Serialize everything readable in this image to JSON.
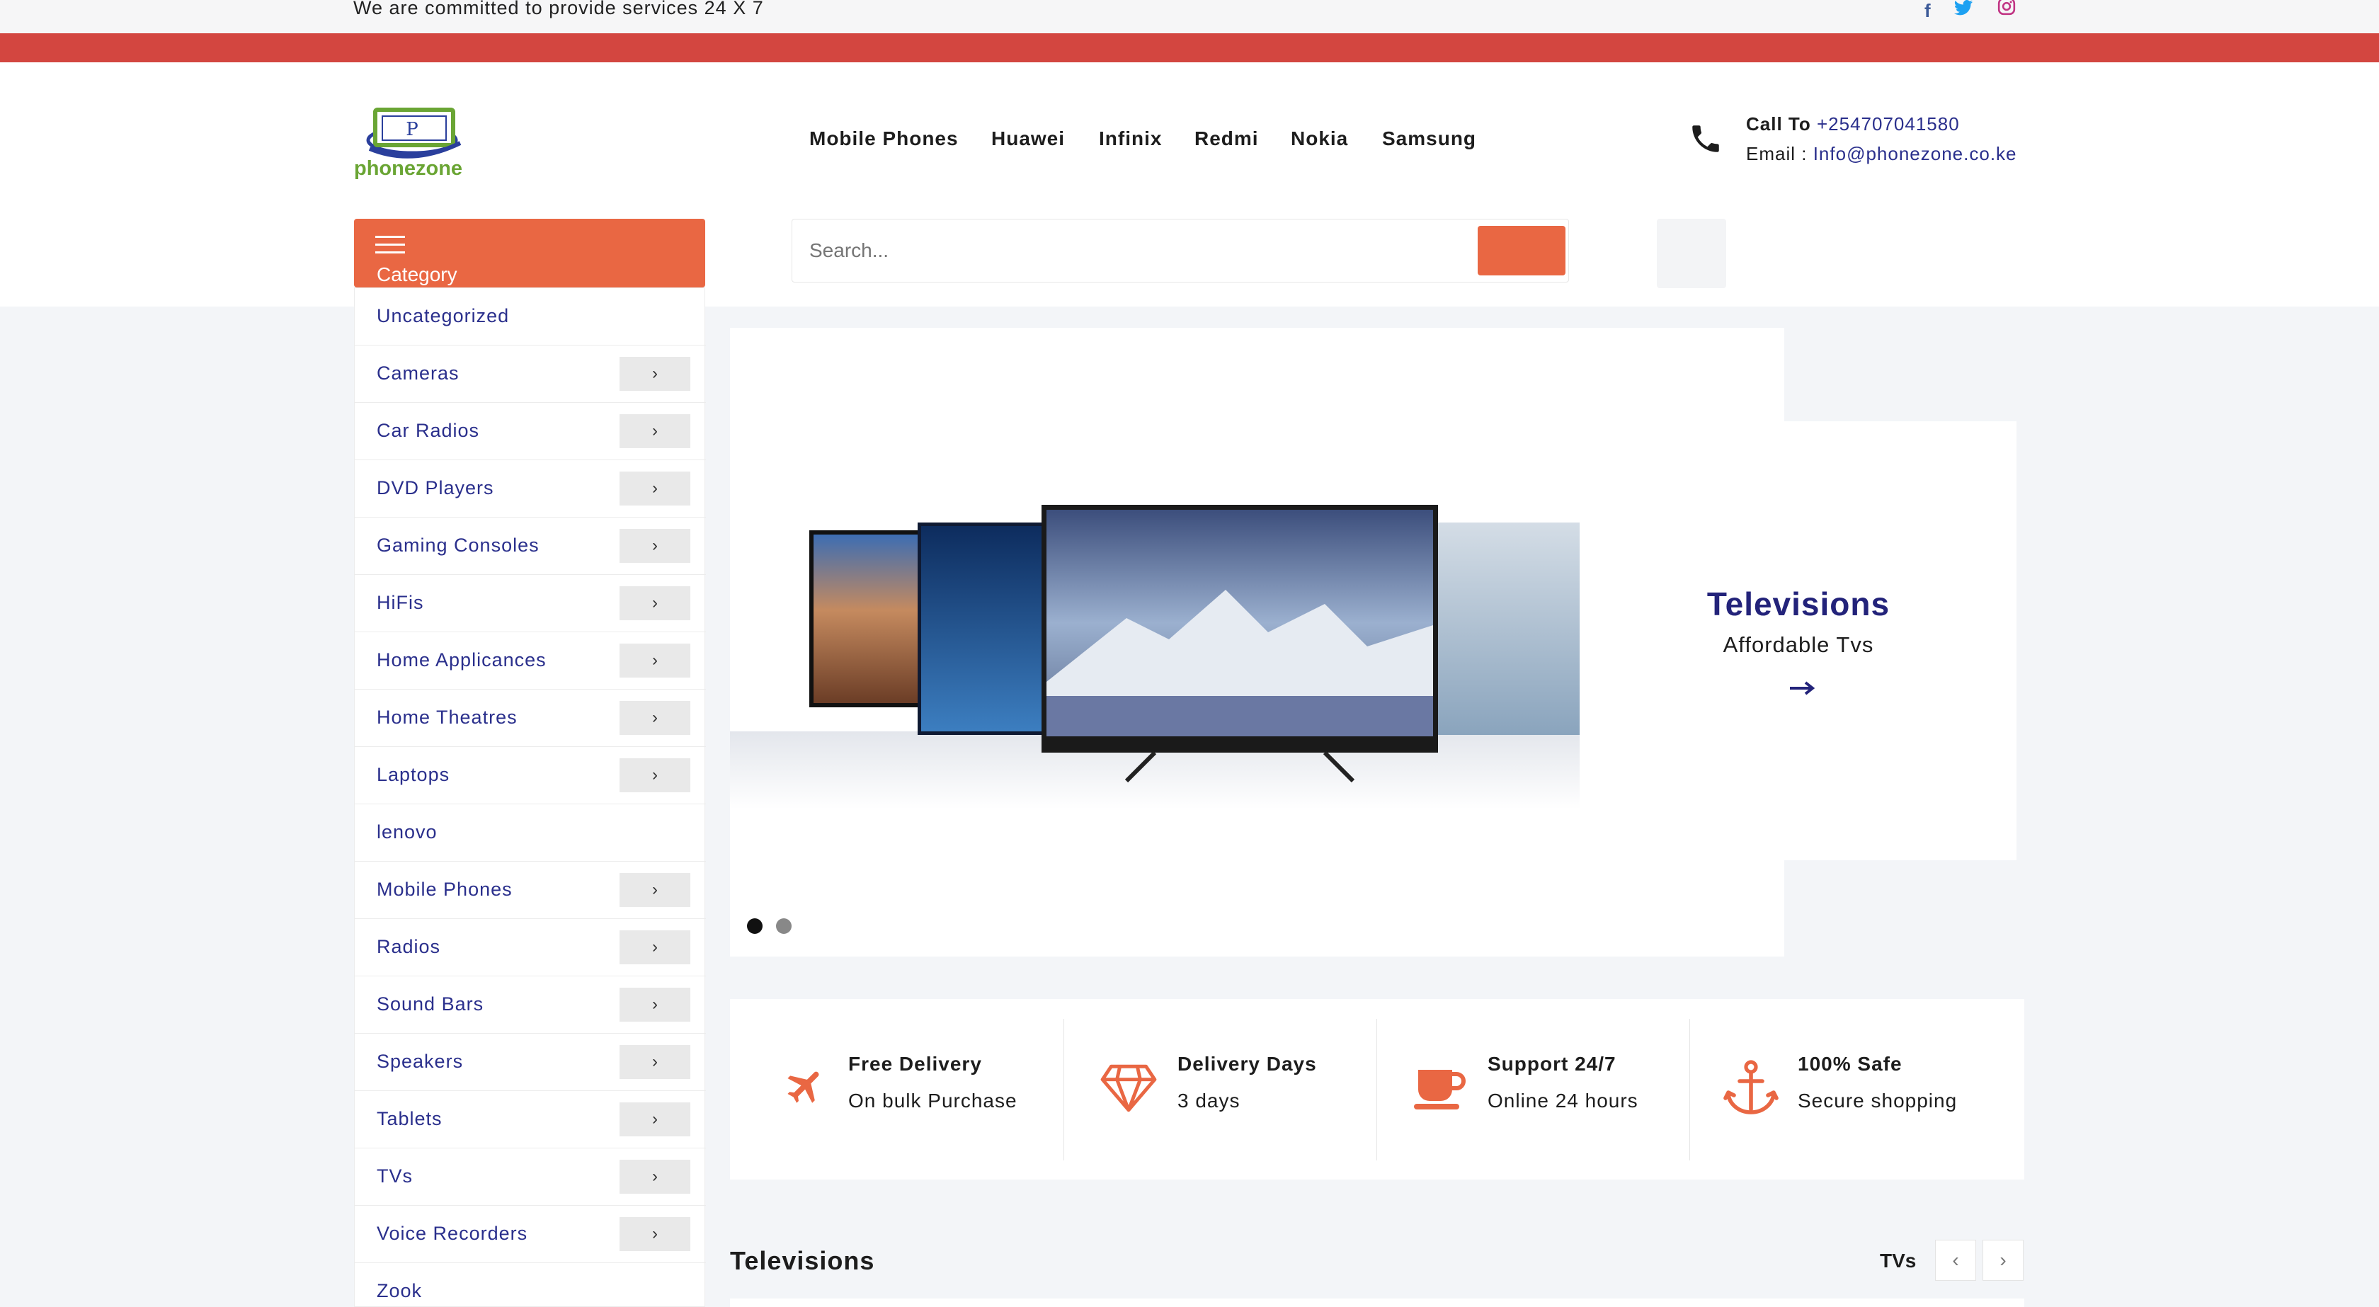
{
  "topbar": {
    "text": "We are committed to provide services 24 X 7",
    "social": [
      {
        "name": "facebook-icon",
        "glyph": "f",
        "color": "#3b5998"
      },
      {
        "name": "twitter-icon",
        "glyph": "🐦",
        "color": "#1da1f2"
      },
      {
        "name": "instagram-icon",
        "glyph": "◎",
        "color": "#c13584"
      }
    ]
  },
  "header": {
    "logo_text": "phonezone",
    "nav": [
      "Mobile Phones",
      "Huawei",
      "Infinix",
      "Redmi",
      "Nokia",
      "Samsung"
    ],
    "call_label": "Call To",
    "call_value": "+254707041580",
    "email_label": "Email :",
    "email_value": "Info@phonezone.co.ke"
  },
  "category": {
    "title": "Category",
    "items": [
      {
        "label": "Uncategorized",
        "has_children": false
      },
      {
        "label": "Cameras",
        "has_children": true
      },
      {
        "label": "Car Radios",
        "has_children": true
      },
      {
        "label": "DVD Players",
        "has_children": true
      },
      {
        "label": "Gaming Consoles",
        "has_children": true
      },
      {
        "label": "HiFis",
        "has_children": true
      },
      {
        "label": "Home Applicances",
        "has_children": true
      },
      {
        "label": "Home Theatres",
        "has_children": true
      },
      {
        "label": "Laptops",
        "has_children": true
      },
      {
        "label": "lenovo",
        "has_children": false
      },
      {
        "label": "Mobile Phones",
        "has_children": true
      },
      {
        "label": "Radios",
        "has_children": true
      },
      {
        "label": "Sound Bars",
        "has_children": true
      },
      {
        "label": "Speakers",
        "has_children": true
      },
      {
        "label": "Tablets",
        "has_children": true
      },
      {
        "label": "TVs",
        "has_children": true
      },
      {
        "label": "Voice Recorders",
        "has_children": true
      },
      {
        "label": "Zook",
        "has_children": false
      }
    ]
  },
  "search": {
    "placeholder": "Search..."
  },
  "slider": {
    "title": "Televisions",
    "subtitle": "Affordable Tvs",
    "active_slide": 1,
    "slide_count": 2
  },
  "features": [
    {
      "title": "Free Delivery",
      "subtitle": "On bulk Purchase",
      "icon": "airplane-icon"
    },
    {
      "title": "Delivery Days",
      "subtitle": "3 days",
      "icon": "diamond-icon"
    },
    {
      "title": "Support 24/7",
      "subtitle": "Online 24 hours",
      "icon": "coffee-cup-icon"
    },
    {
      "title": "100% Safe",
      "subtitle": "Secure shopping",
      "icon": "anchor-icon"
    }
  ],
  "section": {
    "title": "Televisions",
    "tab": "TVs"
  },
  "colors": {
    "accent": "#e96743",
    "red_bar": "#d34640",
    "link": "#2a2f8c",
    "promo_title": "#23237a"
  }
}
